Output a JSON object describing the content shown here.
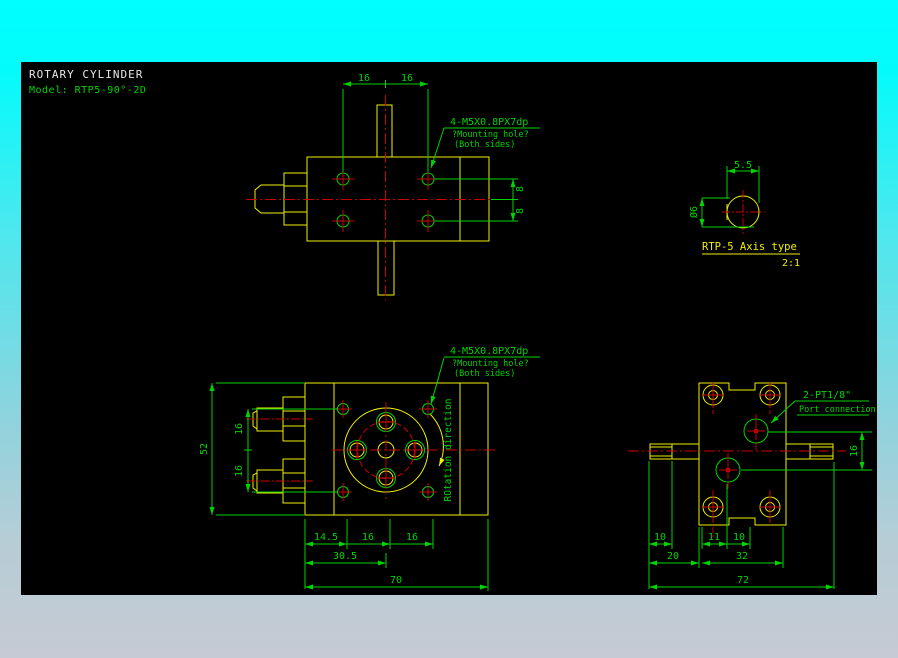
{
  "colors": {
    "background_top": "#00ffff",
    "background_bottom": "#c6cad4",
    "canvas": "#000000",
    "outline_yellow": "#f0f000",
    "dimension_green": "#00d400",
    "centerline_red": "#cc0000",
    "title_white": "#e8e8e8"
  },
  "title_block": {
    "title": "ROTARY CYLINDER",
    "model": "Model:  RTP5-90°-2D"
  },
  "top_view": {
    "dim_16_left": "16",
    "dim_16_right": "16",
    "dim_8_upper": "8",
    "dim_8_lower": "8",
    "note_line1": "4-M5X0.8PX7dp",
    "note_line2": "?Mounting hole?",
    "note_line3": "(Both sides)"
  },
  "axis_detail": {
    "dim_width": "5.5",
    "dim_diameter": "Ø6",
    "label": "RTP-5 Axis type",
    "scale": "2:1"
  },
  "front_view": {
    "note_line1": "4-M5X0.8PX7dp",
    "note_line2": "?Mounting hole?",
    "note_line3": "(Both sides)",
    "dim_height": "52",
    "dim_16_upper": "16",
    "dim_16_lower": "16",
    "rotation_label": "ROtation direction",
    "dim_14_5": "14.5",
    "dim_16_a": "16",
    "dim_16_b": "16",
    "dim_30_5": "30.5",
    "dim_70": "70"
  },
  "side_view": {
    "note_line1": "2-PT1/8\"",
    "note_line2": "Port connection",
    "dim_16": "16",
    "dim_10_a": "10",
    "dim_11": "11",
    "dim_10_b": "10",
    "dim_20": "20",
    "dim_32": "32",
    "dim_72": "72"
  }
}
